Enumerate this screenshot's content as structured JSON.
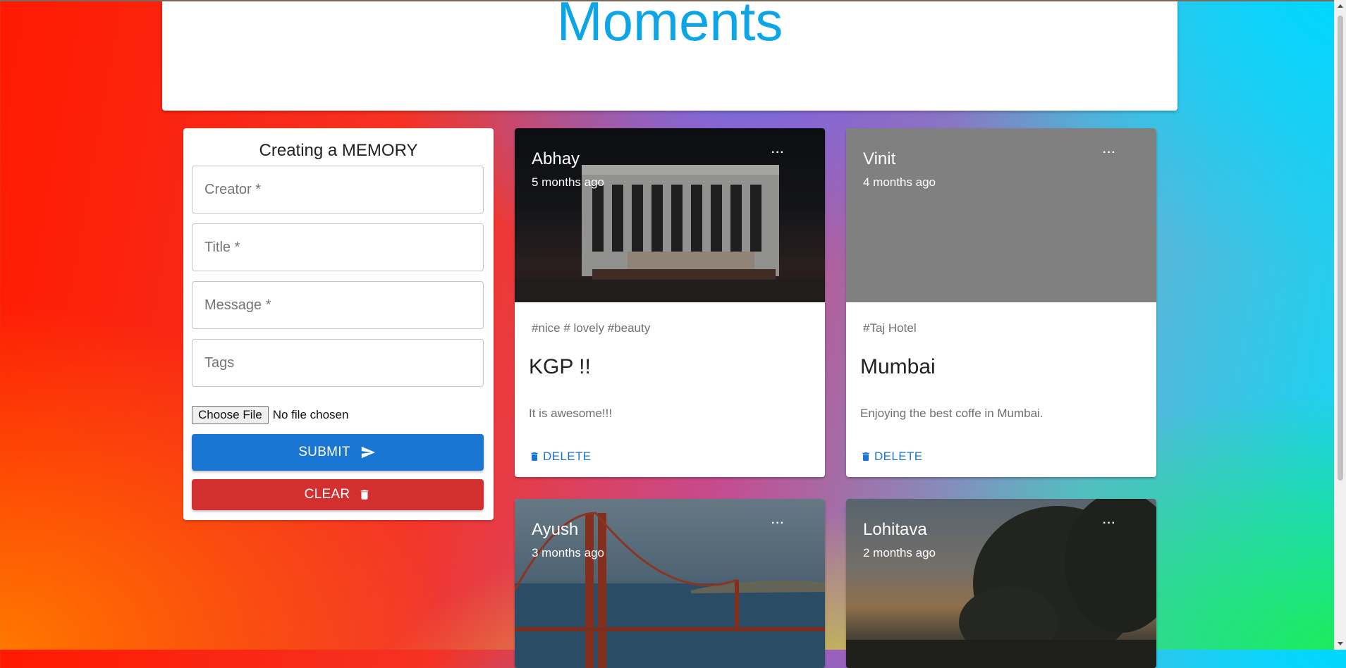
{
  "header": {
    "brand": "Moments"
  },
  "form": {
    "title": "Creating a MEMORY",
    "fields": {
      "creator": "Creator *",
      "title": "Title *",
      "message": "Message *",
      "tags": "Tags"
    },
    "file": {
      "button_label": "Choose File",
      "status": "No file chosen"
    },
    "submit_label": "SUBMIT",
    "clear_label": "CLEAR"
  },
  "colors": {
    "brand": "#0ea5e6",
    "primary": "#1976d2",
    "danger": "#d32f2f"
  },
  "posts": [
    {
      "creator": "Abhay",
      "time": "5 months ago",
      "more": "···",
      "tags": "#nice # lovely #beauty",
      "title": "KGP !!",
      "message": "It is awesome!!!",
      "delete_label": "DELETE"
    },
    {
      "creator": "Vinit",
      "time": "4 months ago",
      "more": "···",
      "tags": "#Taj Hotel",
      "title": "Mumbai",
      "message": "Enjoying the best coffe in Mumbai.",
      "delete_label": "DELETE"
    },
    {
      "creator": "Ayush",
      "time": "3 months ago",
      "more": "···"
    },
    {
      "creator": "Lohitava",
      "time": "2 months ago",
      "more": "···"
    }
  ]
}
